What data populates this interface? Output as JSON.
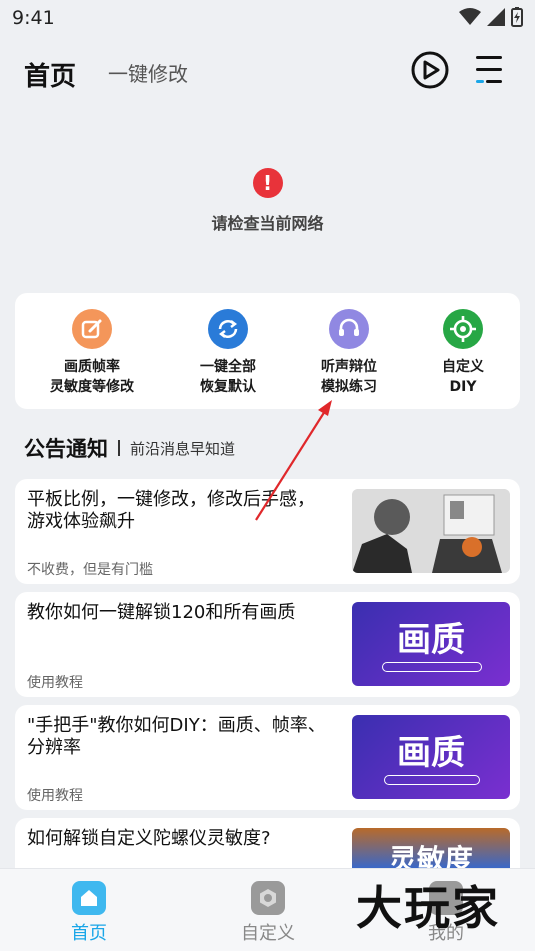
{
  "status_bar": {
    "time": "9:41"
  },
  "header": {
    "title": "首页",
    "subtitle": "一键修改"
  },
  "network_error": {
    "message": "请检查当前网络"
  },
  "features": [
    {
      "label_line1": "画质帧率",
      "label_line2": "灵敏度等修改",
      "icon": "edit-icon",
      "color": "#f08a4b"
    },
    {
      "label_line1": "一键全部",
      "label_line2": "恢复默认",
      "icon": "refresh-icon",
      "color": "#2a7bd8"
    },
    {
      "label_line1": "听声辩位",
      "label_line2": "模拟练习",
      "icon": "headset-icon",
      "color": "#8f86e0"
    },
    {
      "label_line1": "自定义",
      "label_line2": "DIY",
      "icon": "crosshair-icon",
      "color": "#28a745"
    }
  ],
  "notice": {
    "title": "公告通知",
    "subtitle": "前沿消息早知道"
  },
  "articles": [
    {
      "title": "平板比例，一键修改，修改后手感，游戏体验飙升",
      "tag": "不收费，但是有门槛"
    },
    {
      "title": "教你如何一键解锁120和所有画质",
      "tag": "使用教程",
      "thumb_text": "画质"
    },
    {
      "title": "\"手把手\"教你如何DIY：画质、帧率、分辨率",
      "tag": "使用教程",
      "thumb_text": "画质"
    },
    {
      "title": "如何解锁自定义陀螺仪灵敏度?",
      "tag": "",
      "thumb_text": "灵敏度"
    }
  ],
  "bottom_nav": [
    {
      "label": "首页",
      "active": true
    },
    {
      "label": "自定义",
      "active": false
    },
    {
      "label": "我的",
      "active": false
    }
  ],
  "watermark": "大玩家",
  "colors": {
    "accent": "#1aa6e8",
    "error": "#e8333a"
  }
}
